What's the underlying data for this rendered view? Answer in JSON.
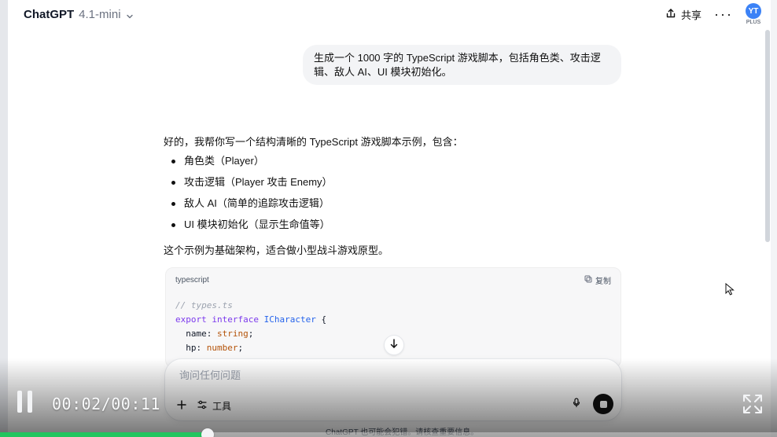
{
  "header": {
    "model_name": "ChatGPT",
    "model_version": "4.1-mini",
    "share_label": "共享",
    "more_label": "···",
    "avatar_initials": "YT",
    "plan_label": "PLUS"
  },
  "conversation": {
    "user_message": "生成一个 1000 字的 TypeScript 游戏脚本，包括角色类、攻击逻辑、敌人 AI、UI 模块初始化。",
    "assistant_intro": "好的，我帮你写一个结构清晰的 TypeScript 游戏脚本示例，包含：",
    "assistant_items": [
      "角色类（Player）",
      "攻击逻辑（Player 攻击 Enemy）",
      "敌人 AI（简单的追踪攻击逻辑）",
      "UI 模块初始化（显示生命值等）"
    ],
    "assistant_outro": "这个示例为基础架构，适合做小型战斗游戏原型。"
  },
  "code_block": {
    "language_label": "typescript",
    "copy_label": "复制",
    "line_1_comment": "// types.ts",
    "line_2_kw_1": "export",
    "line_2_kw_2": "interface",
    "line_2_type": "ICharacter",
    "line_2_brace": " {",
    "line_3_prop": "name",
    "line_3_colon": ": ",
    "line_3_type": "string",
    "line_3_semi": ";",
    "line_4_prop": "hp",
    "line_4_colon": ": ",
    "line_4_type": "number",
    "line_4_semi": ";"
  },
  "composer": {
    "placeholder": "询问任何问题",
    "tools_label": "工具"
  },
  "footer": {
    "disclaimer": "ChatGPT 也可能会犯错。请核查重要信息。"
  },
  "video": {
    "time_display": "00:02/00:11",
    "progress": 0.267
  },
  "colors": {
    "progress_fill": "#22c55e",
    "avatar_bg": "#3b82f6"
  }
}
